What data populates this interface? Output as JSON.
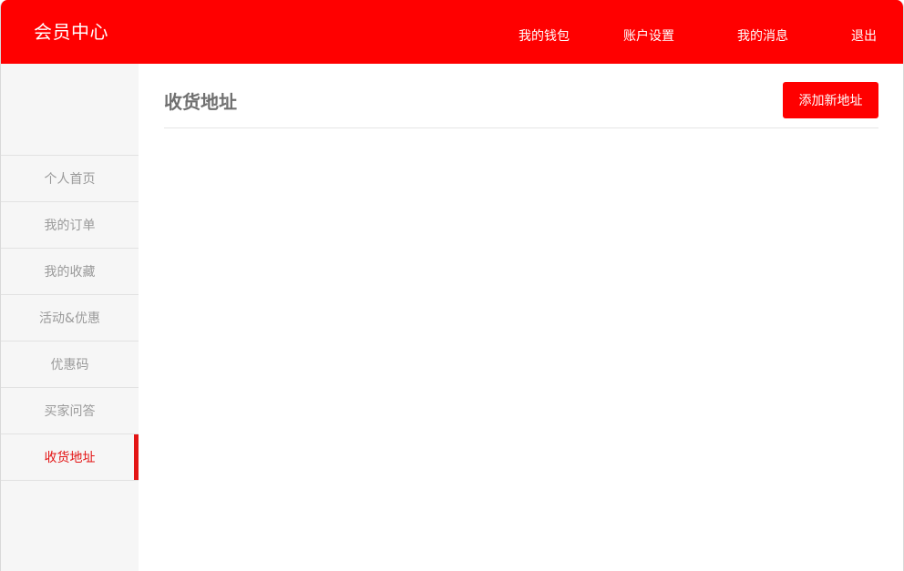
{
  "header": {
    "brand": "会员中心",
    "nav": {
      "wallet": "我的钱包",
      "settings": "账户设置",
      "messages": "我的消息",
      "logout": "退出"
    }
  },
  "sidebar": {
    "items": [
      {
        "label": "个人首页"
      },
      {
        "label": "我的订单"
      },
      {
        "label": "我的收藏"
      },
      {
        "label": "活动&优惠"
      },
      {
        "label": "优惠码"
      },
      {
        "label": "买家问答"
      },
      {
        "label": "收货地址",
        "active": true
      }
    ]
  },
  "main": {
    "title": "收货地址",
    "add_button": "添加新地址"
  },
  "colors": {
    "brand_red": "#ff0000",
    "active_red": "#e31515",
    "sidebar_bg": "#f6f6f6",
    "muted_text": "#9a9a9a"
  }
}
